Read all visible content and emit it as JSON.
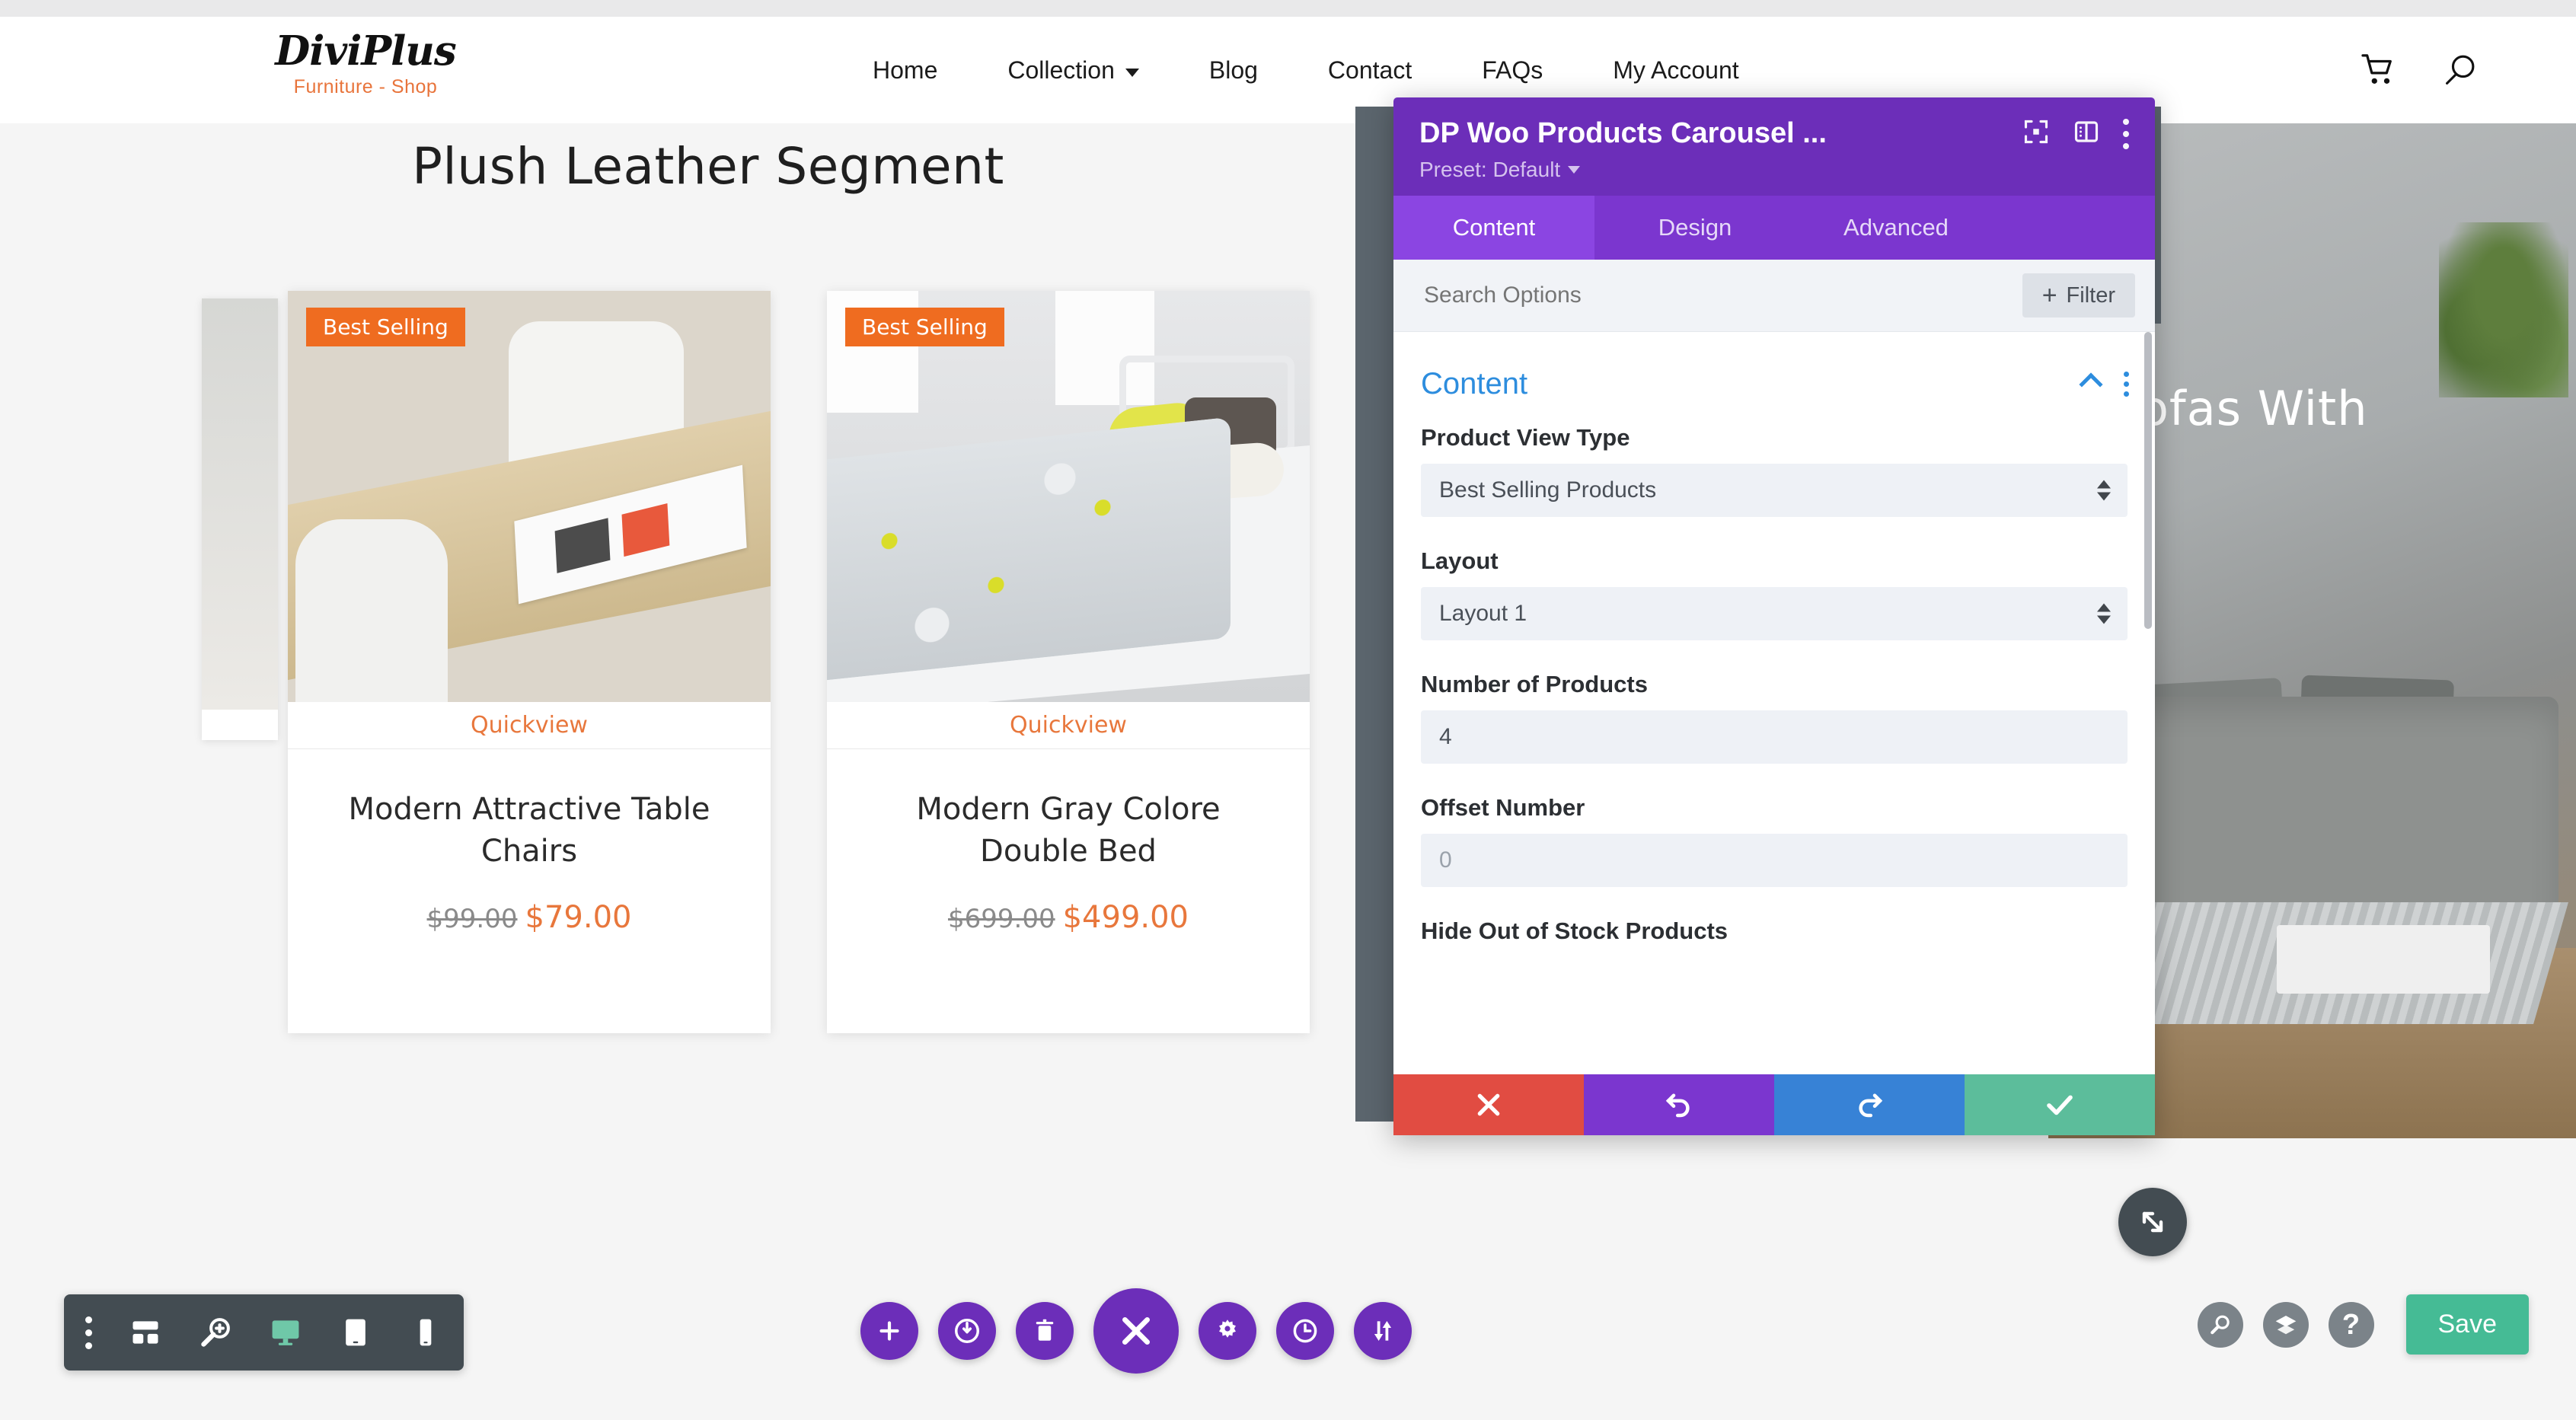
{
  "site": {
    "logo": {
      "main": "DiviPlus",
      "sub": "Furniture - Shop"
    },
    "nav": [
      {
        "label": "Home",
        "has_dropdown": false
      },
      {
        "label": "Collection",
        "has_dropdown": true
      },
      {
        "label": "Blog",
        "has_dropdown": false
      },
      {
        "label": "Contact",
        "has_dropdown": false
      },
      {
        "label": "FAQs",
        "has_dropdown": false
      },
      {
        "label": "My Account",
        "has_dropdown": false
      }
    ],
    "icons": [
      {
        "name": "cart-icon"
      },
      {
        "name": "search-icon"
      }
    ],
    "page_title": "Plush Leather Segment",
    "hero_text": "ofas With"
  },
  "carousel": {
    "products": [
      {
        "badge": "Best Selling",
        "quickview": "Quickview",
        "name": "Modern Attractive Table\nChairs",
        "price_old": "$99.00",
        "price_new": "$79.00"
      },
      {
        "badge": "Best Selling",
        "quickview": "Quickview",
        "name": "Modern Gray Colore\nDouble Bed",
        "price_old": "$699.00",
        "price_new": "$499.00"
      }
    ]
  },
  "modal": {
    "title": "DP Woo Products Carousel ...",
    "preset_label": "Preset: Default",
    "header_icons": [
      {
        "name": "focus-module-icon"
      },
      {
        "name": "panel-layout-icon"
      },
      {
        "name": "more-options-icon"
      }
    ],
    "tabs": [
      {
        "label": "Content",
        "active": true
      },
      {
        "label": "Design",
        "active": false
      },
      {
        "label": "Advanced",
        "active": false
      }
    ],
    "search_placeholder": "Search Options",
    "search_value": "",
    "filter_label": "Filter",
    "section": {
      "title": "Content",
      "collapsed": false
    },
    "fields": [
      {
        "label": "Product View Type",
        "type": "select",
        "value": "Best Selling Products",
        "is_placeholder": false
      },
      {
        "label": "Layout",
        "type": "select",
        "value": "Layout 1",
        "is_placeholder": false
      },
      {
        "label": "Number of Products",
        "type": "text",
        "value": "4",
        "is_placeholder": false
      },
      {
        "label": "Offset Number",
        "type": "text",
        "value": "0",
        "is_placeholder": true
      }
    ],
    "next_field_label": "Hide Out of Stock Products",
    "footer": [
      {
        "name": "cancel-changes-button",
        "icon": "close-icon",
        "color": "#e14c42"
      },
      {
        "name": "undo-button",
        "icon": "undo-icon",
        "color": "#7b36cf"
      },
      {
        "name": "redo-button",
        "icon": "redo-icon",
        "color": "#3782d6"
      },
      {
        "name": "save-changes-button",
        "icon": "check-icon",
        "color": "#5cbd9b"
      }
    ],
    "resize_handle": "resize-icon"
  },
  "builder_bar": {
    "left_tools": [
      {
        "name": "more-options-icon",
        "active": false
      },
      {
        "name": "wireframe-view-icon",
        "active": false
      },
      {
        "name": "zoom-out-view-icon",
        "active": false
      },
      {
        "name": "desktop-view-icon",
        "active": true
      },
      {
        "name": "tablet-view-icon",
        "active": false
      },
      {
        "name": "phone-view-icon",
        "active": false
      }
    ],
    "center_tools": [
      {
        "name": "add-section-button",
        "icon": "plus-icon",
        "big": false
      },
      {
        "name": "page-settings-button",
        "icon": "power-icon",
        "big": false
      },
      {
        "name": "delete-button",
        "icon": "trash-icon",
        "big": false
      },
      {
        "name": "close-builder-button",
        "icon": "close-icon",
        "big": true
      },
      {
        "name": "settings-button",
        "icon": "gear-icon",
        "big": false
      },
      {
        "name": "history-button",
        "icon": "clock-icon",
        "big": false
      },
      {
        "name": "sort-button",
        "icon": "updown-arrows-icon",
        "big": false
      }
    ],
    "right_tools": [
      {
        "name": "search-button",
        "icon": "search-icon"
      },
      {
        "name": "layers-button",
        "icon": "layers-icon"
      },
      {
        "name": "help-button",
        "icon": "help-icon"
      }
    ],
    "save_label": "Save"
  },
  "colors": {
    "divi_purple": "#6c2eb9",
    "tab_purple": "#7b36cf",
    "tab_active": "#8b45e2",
    "accent_orange": "#e8773c",
    "badge_orange": "#ef6c20",
    "save_green": "#45bb95",
    "section_blue": "#2d8dde",
    "toolbar_dark": "#434c52"
  }
}
